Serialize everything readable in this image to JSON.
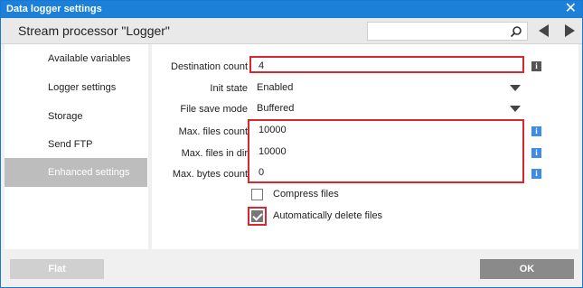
{
  "window": {
    "title": "Data logger settings",
    "close_glyph": "✕"
  },
  "header": {
    "title": "Stream processor \"Logger\"",
    "search_value": "",
    "search_placeholder": ""
  },
  "sidebar": {
    "items": [
      {
        "label": "Available variables",
        "active": false
      },
      {
        "label": "Logger settings",
        "active": false
      },
      {
        "label": "Storage",
        "active": false
      },
      {
        "label": "Send FTP",
        "active": false
      },
      {
        "label": "Enhanced settings",
        "active": true
      }
    ]
  },
  "form": {
    "destination_count": {
      "label": "Destination count",
      "value": "4"
    },
    "init_state": {
      "label": "Init state",
      "value": "Enabled"
    },
    "file_save_mode": {
      "label": "File save mode",
      "value": "Buffered"
    },
    "max_files_count": {
      "label": "Max. files count",
      "value": "10000"
    },
    "max_files_in_dir": {
      "label": "Max. files in dir",
      "value": "10000"
    },
    "max_bytes_count": {
      "label": "Max. bytes count",
      "value": "0"
    },
    "compress_files": {
      "label": "Compress files",
      "checked": false
    },
    "auto_delete": {
      "label": "Automatically delete files",
      "checked": true
    },
    "info_glyph": "i"
  },
  "footer": {
    "flat_label": "Flat",
    "ok_label": "OK"
  },
  "colors": {
    "titlebar": "#1c7fd8",
    "highlight": "#d9262f",
    "info_blue": "#3f8be6",
    "info_gray": "#555555",
    "active_item": "#bdbdbd"
  },
  "icons": {
    "search": "search-icon",
    "prev": "triangle-left-icon",
    "next": "triangle-right-icon",
    "close": "close-icon"
  }
}
